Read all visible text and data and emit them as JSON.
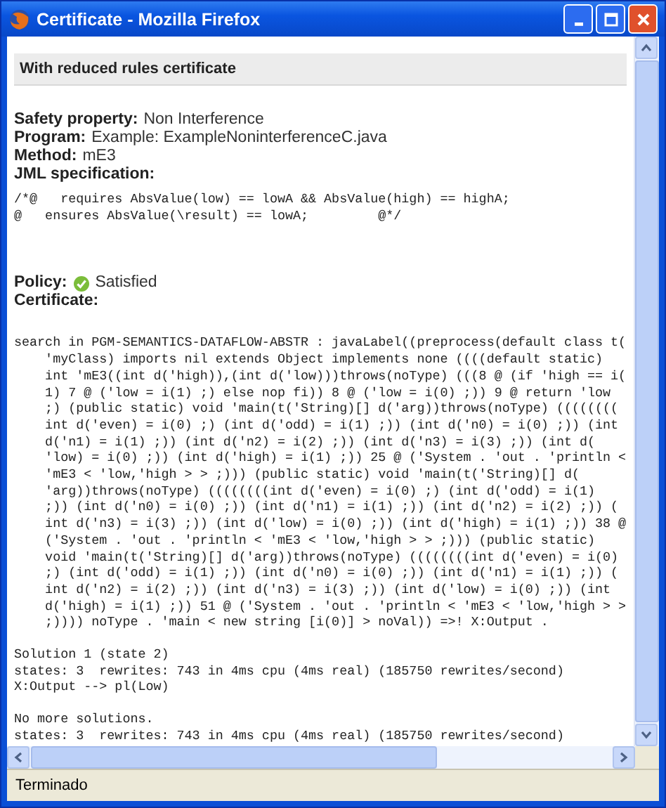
{
  "window": {
    "title": "Certificate - Mozilla Firefox"
  },
  "page": {
    "heading": "With reduced rules certificate",
    "properties": [
      {
        "label": "Safety property:",
        "value": "Non Interference"
      },
      {
        "label": "Program:",
        "value": "Example: ExampleNoninterferenceC.java"
      },
      {
        "label": "Method:",
        "value": "mE3"
      },
      {
        "label": "JML specification:"
      }
    ],
    "jml_lines": [
      "/*@   requires AbsValue(low) == lowA && AbsValue(high) == highA;",
      "@   ensures AbsValue(\\result) == lowA;         @*/"
    ],
    "policy": {
      "label": "Policy:",
      "value": "Satisfied"
    },
    "certificate_label": "Certificate:",
    "certificate_blocks": [
      [
        "search in PGM-SEMANTICS-DATAFLOW-ABSTR : javaLabel((preprocess(default class t(",
        "    'myClass) imports nil extends Object implements none ((((default static)",
        "    int 'mE3((int d('high)),(int d('low)))throws(noType) (((8 @ (if 'high == i(",
        "    1) 7 @ ('low = i(1) ;) else nop fi)) 8 @ ('low = i(0) ;)) 9 @ return 'low",
        "    ;) (public static) void 'main(t('String)[] d('arg))throws(noType) ((((((((",
        "    int d('even) = i(0) ;) (int d('odd) = i(1) ;)) (int d('n0) = i(0) ;)) (int",
        "    d('n1) = i(1) ;)) (int d('n2) = i(2) ;)) (int d('n3) = i(3) ;)) (int d(",
        "    'low) = i(0) ;)) (int d('high) = i(1) ;)) 25 @ ('System . 'out . 'println <",
        "    'mE3 < 'low,'high > > ;))) (public static) void 'main(t('String)[] d(",
        "    'arg))throws(noType) ((((((((int d('even) = i(0) ;) (int d('odd) = i(1)",
        "    ;)) (int d('n0) = i(0) ;)) (int d('n1) = i(1) ;)) (int d('n2) = i(2) ;)) (",
        "    int d('n3) = i(3) ;)) (int d('low) = i(0) ;)) (int d('high) = i(1) ;)) 38 @",
        "    ('System . 'out . 'println < 'mE3 < 'low,'high > > ;))) (public static)",
        "    void 'main(t('String)[] d('arg))throws(noType) ((((((((int d('even) = i(0)",
        "    ;) (int d('odd) = i(1) ;)) (int d('n0) = i(0) ;)) (int d('n1) = i(1) ;)) (",
        "    int d('n2) = i(2) ;)) (int d('n3) = i(3) ;)) (int d('low) = i(0) ;)) (int",
        "    d('high) = i(1) ;)) 51 @ ('System . 'out . 'println < 'mE3 < 'low,'high > >",
        "    ;)))) noType . 'main < new string [i(0)] > noVal)) =>! X:Output ."
      ],
      [
        "Solution 1 (state 2)",
        "states: 3  rewrites: 743 in 4ms cpu (4ms real) (185750 rewrites/second)",
        "X:Output --> pl(Low)"
      ],
      [
        "No more solutions.",
        "states: 3  rewrites: 743 in 4ms cpu (4ms real) (185750 rewrites/second)"
      ]
    ]
  },
  "status_bar": {
    "text": "Terminado"
  }
}
